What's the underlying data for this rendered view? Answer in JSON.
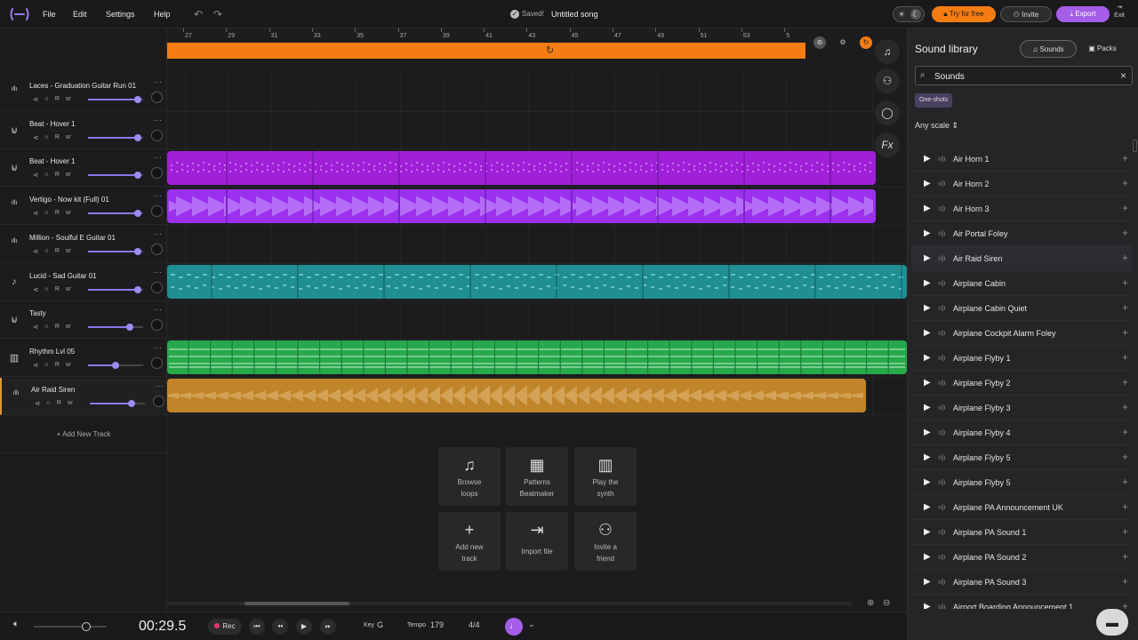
{
  "menu": {
    "file": "File",
    "edit": "Edit",
    "settings": "Settings",
    "help": "Help"
  },
  "header": {
    "saved": "Saved!",
    "song_title": "Untitled song",
    "try_free": "Try for free",
    "invite": "Invite",
    "export": "Export",
    "exit": "Exit"
  },
  "ruler": {
    "ticks": [
      "27",
      "29",
      "31",
      "33",
      "35",
      "37",
      "39",
      "41",
      "43",
      "45",
      "47",
      "49",
      "51",
      "53",
      "5"
    ]
  },
  "tracks": [
    {
      "name": "Laces - Graduation Guitar Run 01",
      "icon": "waveform-icon",
      "volume": 0.9
    },
    {
      "name": "Beat - Hover 1",
      "icon": "drum-icon",
      "volume": 0.9
    },
    {
      "name": "Beat - Hover 1",
      "icon": "drum-icon",
      "volume": 0.9
    },
    {
      "name": "Vertigo - Now kit (Full) 01",
      "icon": "waveform-icon",
      "volume": 0.9
    },
    {
      "name": "Million - Soulful E Guitar 01",
      "icon": "waveform-icon",
      "volume": 0.9
    },
    {
      "name": "Lucid - Sad Guitar 01",
      "icon": "guitar-icon",
      "volume": 0.9
    },
    {
      "name": "Tasty",
      "icon": "drum-icon",
      "volume": 0.75
    },
    {
      "name": "Rhythm Lvl 05",
      "icon": "piano-icon",
      "volume": 0.5
    },
    {
      "name": "Air Raid Siren",
      "icon": "waveform-icon",
      "volume": 0.75
    }
  ],
  "track_controls": {
    "mute": "⊲",
    "solo": "∩",
    "record": "R",
    "automation": "ⱳ",
    "more": "···"
  },
  "add_track": "Add New Track",
  "quick_actions": [
    {
      "icon": "♫",
      "label1": "Browse",
      "label2": "loops"
    },
    {
      "icon": "▦",
      "label1": "Patterns",
      "label2": "Beatmaker"
    },
    {
      "icon": "▥",
      "label1": "Play the",
      "label2": "synth"
    },
    {
      "icon": "+",
      "label1": "Add new",
      "label2": "track"
    },
    {
      "icon": "⇥",
      "label1": "Import file",
      "label2": ""
    },
    {
      "icon": "⚇",
      "label1": "Invite a",
      "label2": "friend"
    }
  ],
  "transport": {
    "time": "00:29.5",
    "rec": "Rec",
    "key_label": "Key",
    "key_value": "G",
    "tempo_label": "Tempo",
    "tempo_value": "179",
    "signature": "4/4"
  },
  "library": {
    "title": "Sound library",
    "tab_sounds": "Sounds",
    "tab_packs": "Packs",
    "search_value": "Sounds",
    "chip": "One-shots",
    "scale": "Any scale",
    "sounds": [
      "Air Horn 1",
      "Air Horn 2",
      "Air Horn 3",
      "Air Portal Foley",
      "Air Raid Siren",
      "Airplane Cabin",
      "Airplane Cabin Quiet",
      "Airplane Cockpit Alarm Foley",
      "Airplane Flyby 1",
      "Airplane Flyby 2",
      "Airplane Flyby 3",
      "Airplane Flyby 4",
      "Airplane Flyby 5",
      "Airplane Flyby 5",
      "Airplane PA Announcement UK",
      "Airplane PA Sound 1",
      "Airplane PA Sound 2",
      "Airplane PA Sound 3",
      "Airport Boarding Announcement 1"
    ]
  },
  "colors": {
    "orange": "#f57c12",
    "purple": "#a020d8",
    "violet": "#9b30ee",
    "teal": "#1f8f94",
    "green": "#27a84b",
    "amber": "#c0852a",
    "accent": "#a45ee8"
  }
}
